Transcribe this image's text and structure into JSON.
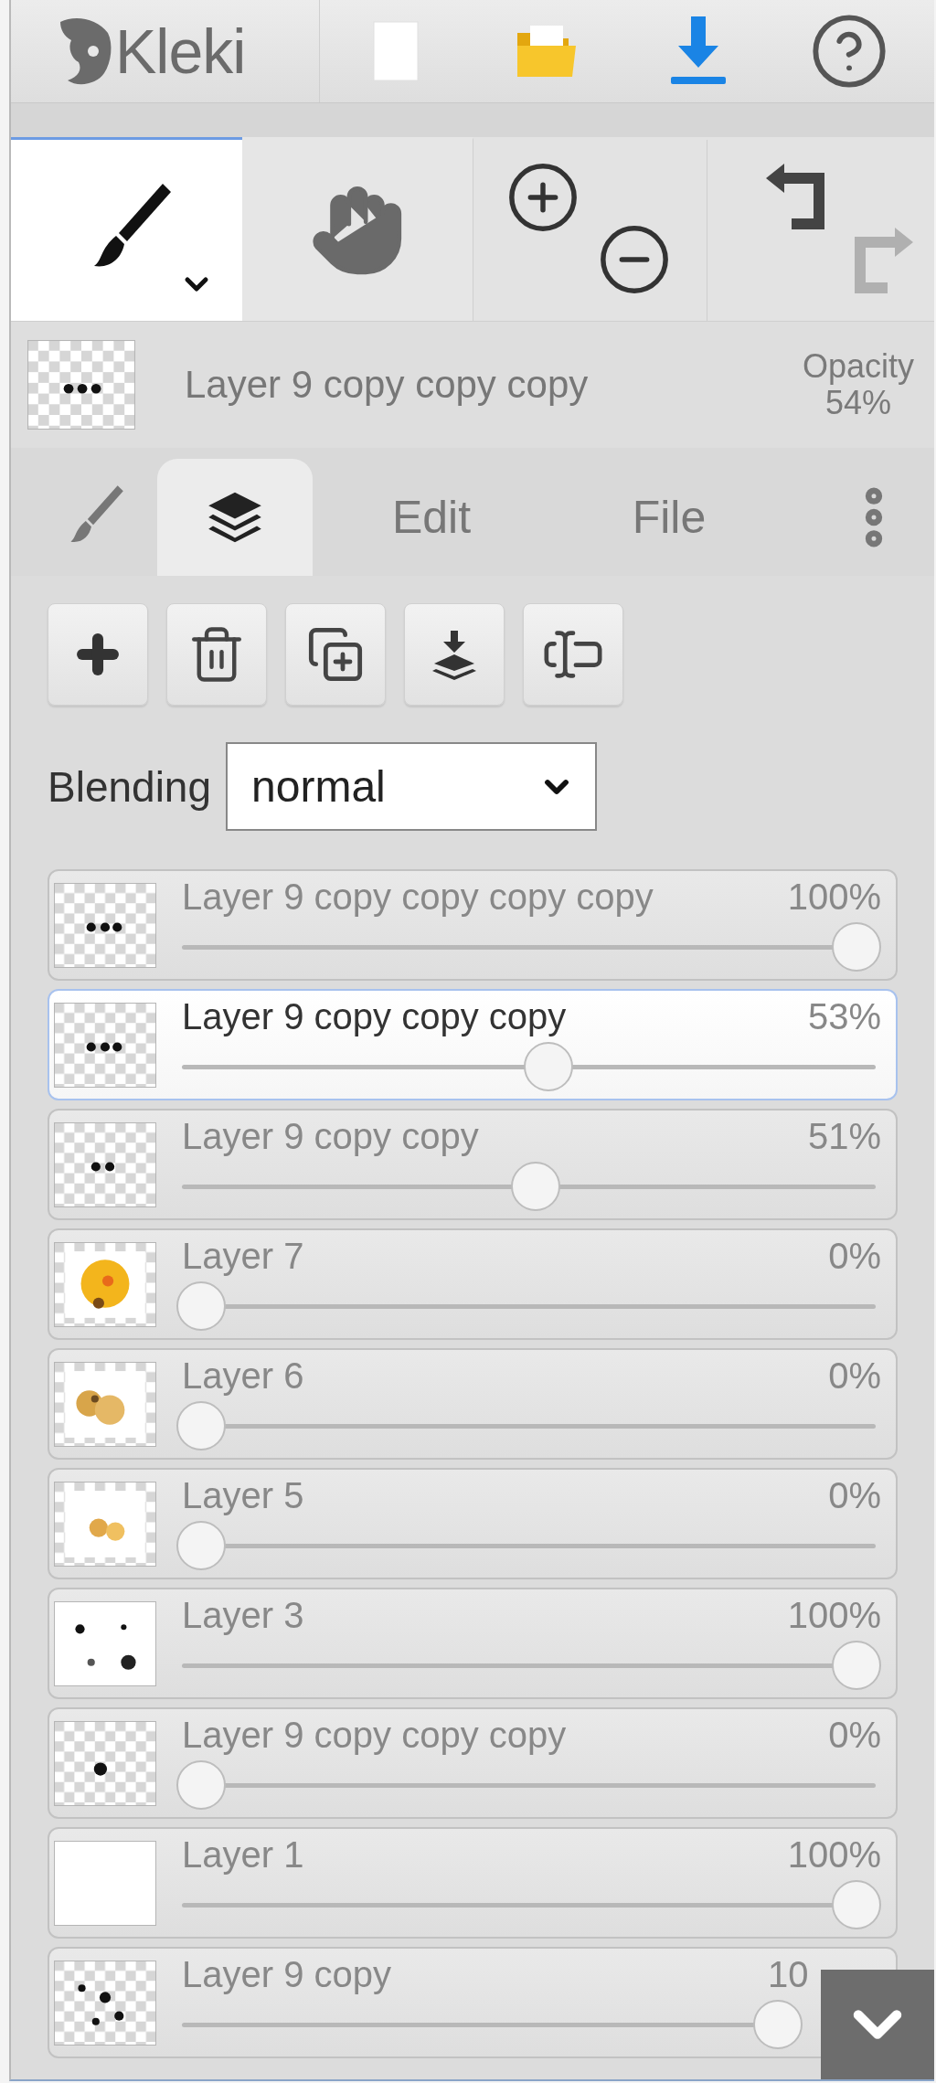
{
  "app": {
    "logo": "Kleki"
  },
  "tools": [
    {
      "kind": "brush",
      "selected": true
    },
    {
      "kind": "hand",
      "selected": false
    }
  ],
  "history": {
    "undo_disabled": false,
    "redo_disabled": true
  },
  "current_layer": {
    "name": "Layer 9 copy copy copy",
    "opacity_label": "Opacity",
    "opacity_value": "54%"
  },
  "tabs": [
    {
      "kind": "brush",
      "selected": false
    },
    {
      "kind": "layers",
      "selected": true
    },
    {
      "kind": "text",
      "label": "Edit",
      "selected": false
    },
    {
      "kind": "text",
      "label": "File",
      "selected": false
    }
  ],
  "blending": {
    "label": "Blending",
    "value": "normal"
  },
  "layers": [
    {
      "name": "Layer 9 copy copy copy copy",
      "opacity": "100%",
      "level": 1,
      "selected": false
    },
    {
      "name": "Layer 9 copy copy copy",
      "opacity": "53%",
      "level": 0.53,
      "selected": true
    },
    {
      "name": "Layer 9 copy copy",
      "opacity": "51%",
      "level": 0.51,
      "selected": false
    },
    {
      "name": "Layer 7",
      "opacity": "0%",
      "level": 0,
      "selected": false
    },
    {
      "name": "Layer 6",
      "opacity": "0%",
      "level": 0,
      "selected": false
    },
    {
      "name": "Layer 5",
      "opacity": "0%",
      "level": 0,
      "selected": false
    },
    {
      "name": "Layer 3",
      "opacity": "100%",
      "level": 1,
      "selected": false
    },
    {
      "name": "Layer 9 copy copy copy",
      "opacity": "0%",
      "level": 0,
      "selected": false
    },
    {
      "name": "Layer 1",
      "opacity": "100%",
      "level": 1,
      "selected": false
    },
    {
      "name": "Layer 9 copy",
      "opacity": "10",
      "level": 1,
      "selected": false
    }
  ]
}
